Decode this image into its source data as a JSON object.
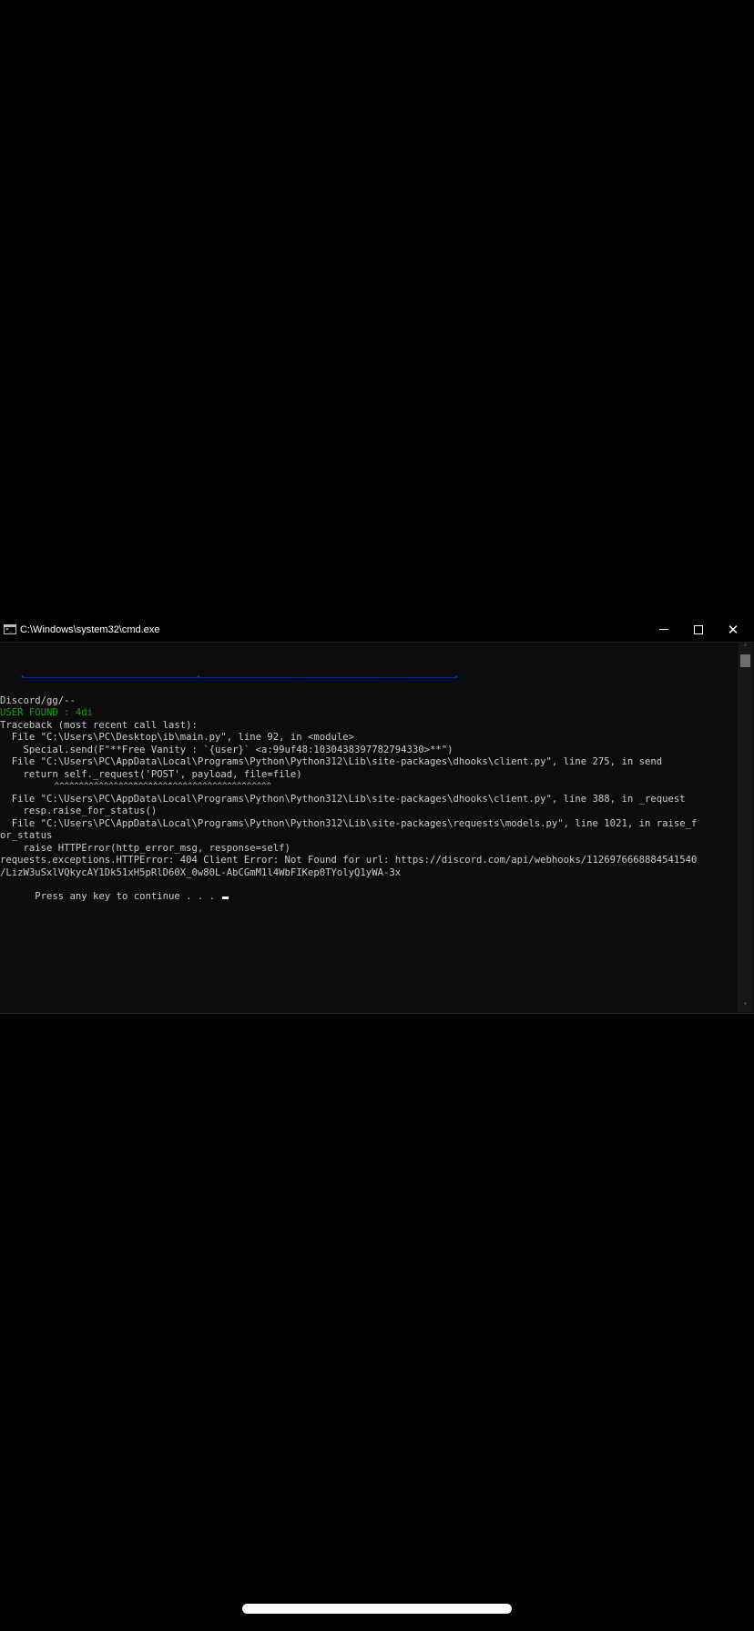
{
  "window": {
    "title": "C:\\Windows\\system32\\cmd.exe",
    "controls": {
      "minimize_icon": "minimize-icon",
      "maximize_icon": "maximize-icon",
      "close_icon": "close-icon",
      "close_glyph": "✕"
    }
  },
  "console": {
    "separator": "•———————————————————————————————————————————————————————————•———————————————————————————————————————————————————————————————————————————————————————•",
    "lines": [
      "Discord/gg/--",
      "USER FOUND : 4di",
      "Traceback (most recent call last):",
      "  File \"C:\\Users\\PC\\Desktop\\ib\\main.py\", line 92, in <module>",
      "    Special.send(F\"**Free Vanity : `{user}` <a:99uf48:1030438397782794330>**\")",
      "  File \"C:\\Users\\PC\\AppData\\Local\\Programs\\Python\\Python312\\Lib\\site-packages\\dhooks\\client.py\", line 275, in send",
      "    return self._request('POST', payload, file=file)",
      "           ^^^^^^^^^^^^^^^^^^^^^^^^^^^^^^^^^^^^^^^^^^^^",
      "  File \"C:\\Users\\PC\\AppData\\Local\\Programs\\Python\\Python312\\Lib\\site-packages\\dhooks\\client.py\", line 388, in _request",
      "    resp.raise_for_status()",
      "  File \"C:\\Users\\PC\\AppData\\Local\\Programs\\Python\\Python312\\Lib\\site-packages\\requests\\models.py\", line 1021, in raise_f",
      "or_status",
      "    raise HTTPError(http_error_msg, response=self)",
      "requests.exceptions.HTTPError: 404 Client Error: Not Found for url: https://discord.com/api/webhooks/1126976668884541540",
      "/LizW3uSxlVQkycAY1Dk51xH5pRlD60X_0w80L-AbCGmM1l4WbFIKep0TYolyQ1yWA-3x",
      "Press any key to continue . . . "
    ]
  },
  "colors": {
    "console_bg": "#0c0c0c",
    "text": "#cccccc",
    "green": "#13a10e",
    "blue": "#0037da",
    "titlebar_bg": "#000000",
    "page_bg": "#000000"
  },
  "scrollbar": {
    "up_arrow": "˄",
    "down_arrow": "˅"
  }
}
